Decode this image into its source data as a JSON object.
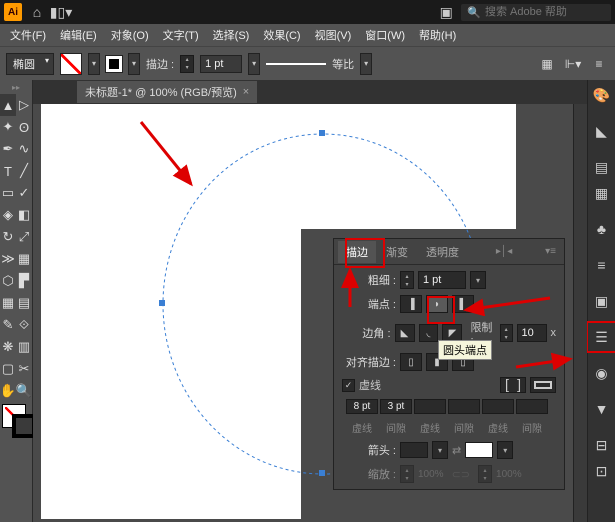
{
  "app": {
    "logo": "Ai",
    "search_placeholder": "搜索 Adobe 帮助"
  },
  "menu": {
    "file": "文件(F)",
    "edit": "编辑(E)",
    "object": "对象(O)",
    "type": "文字(T)",
    "select": "选择(S)",
    "effect": "效果(C)",
    "view": "视图(V)",
    "window": "窗口(W)",
    "help": "帮助(H)"
  },
  "control": {
    "shape": "椭圆",
    "stroke_label": "描边 :",
    "stroke_weight": "1 pt",
    "variable": "等比"
  },
  "doc": {
    "tab_title": "未标题-1* @ 100% (RGB/预览)"
  },
  "panel": {
    "tab_stroke": "描边",
    "tab_gradient": "渐变",
    "tab_transparency": "透明度",
    "weight_label": "粗细 :",
    "weight_value": "1 pt",
    "cap_label": "端点 :",
    "corner_label": "边角 :",
    "limit_label": "限制 :",
    "limit_value": "10",
    "limit_x": "x",
    "align_label": "对齐描边 :",
    "dashed_label": "虚线",
    "dash_values": [
      "8 pt",
      "3 pt",
      "",
      "",
      "",
      ""
    ],
    "dash_labels": [
      "虚线",
      "间隙",
      "虚线",
      "间隙",
      "虚线",
      "间隙"
    ],
    "arrow_label": "箭头 :",
    "scale_label": "缩放 :",
    "scale_val1": "100%",
    "scale_val2": "100%",
    "tooltip": "圆头端点"
  }
}
